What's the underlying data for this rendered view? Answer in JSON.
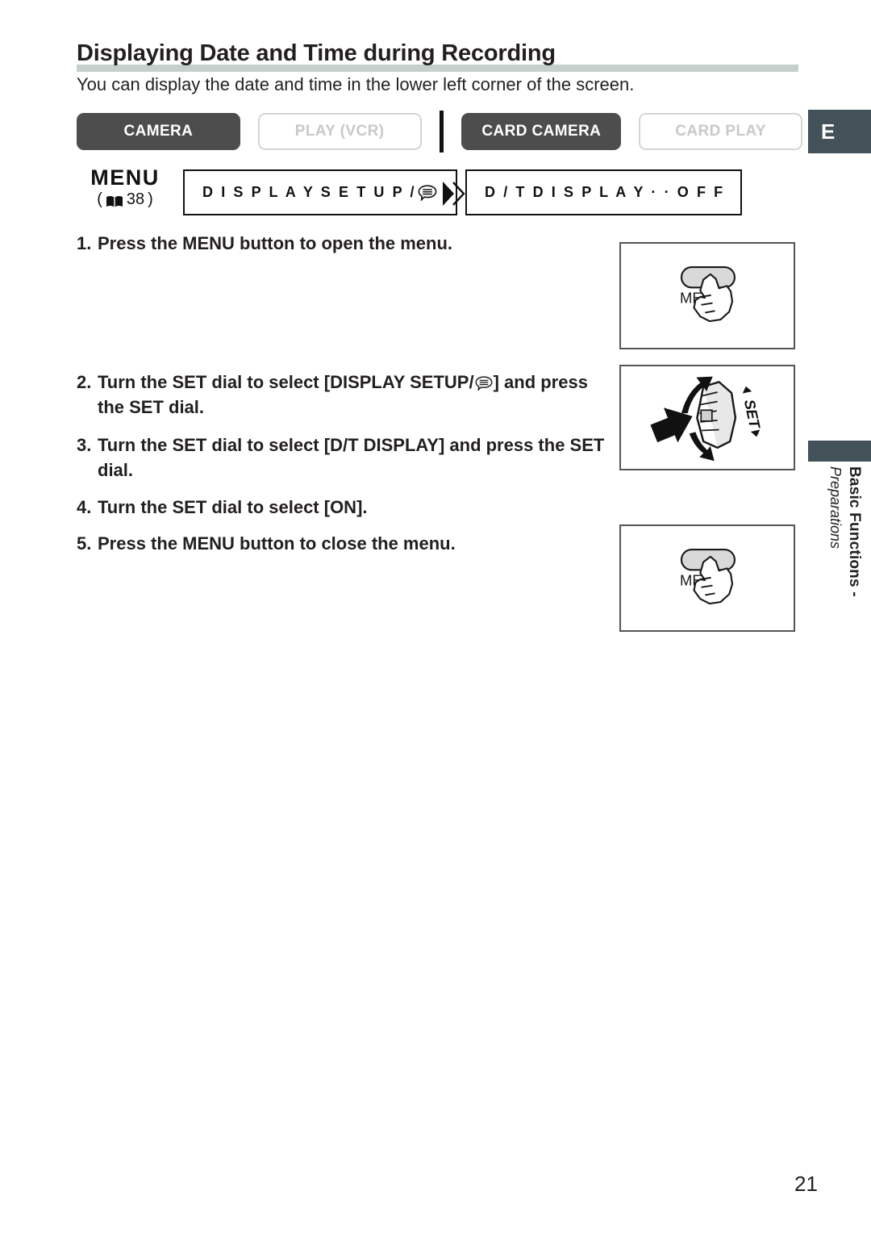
{
  "header": {
    "title": "Displaying Date and Time during Recording",
    "intro": "You can display the date and time in the lower left corner of the screen."
  },
  "modes": [
    {
      "label": "CAMERA",
      "state": "on"
    },
    {
      "label": "PLAY (VCR)",
      "state": "off"
    },
    {
      "label": "CARD CAMERA",
      "state": "on"
    },
    {
      "label": "CARD PLAY",
      "state": "off"
    }
  ],
  "language_tab": {
    "label": "E"
  },
  "menu_flow": {
    "menu_word": "MENU",
    "reference_open": "(",
    "reference_page": "38",
    "reference_close": ")",
    "book_icon": "book-icon",
    "arrow_icon": "double-chevron-right-icon",
    "box1": {
      "text": "D I S P L A Y   S E T U P /",
      "icon": "osd-bubble-icon"
    },
    "box2": {
      "text": "D / T   D I S P L A Y · · O F F"
    }
  },
  "steps": [
    {
      "num": "1.",
      "text": "Press the MENU button to open the menu.",
      "before_icon": null,
      "after_icon": null
    },
    {
      "num": "2.",
      "text_before": "Turn the SET dial to select [DISPLAY SETUP/",
      "icon": "osd-bubble-icon",
      "text_after": "] and press the SET dial."
    },
    {
      "num": "3.",
      "text": "Turn the SET dial to select [D/T DISPLAY] and press the SET dial."
    },
    {
      "num": "4.",
      "text": "Turn the SET dial to select [ON]."
    },
    {
      "num": "5.",
      "text": "Press the MENU button to close the menu."
    }
  ],
  "illustrations": [
    {
      "name": "hand-pressing-menu-button",
      "button_label": "MENU"
    },
    {
      "name": "set-dial-turn-and-press",
      "dial_label": "SET"
    },
    {
      "name": "hand-pressing-menu-button",
      "button_label": "MENU"
    }
  ],
  "side_tab": {
    "main": "Basic Functions -",
    "sub": "Preparations"
  },
  "page_number": "21",
  "colors": {
    "slate": "#435159",
    "button_on": "#4d4d4d",
    "button_off_border": "#d5d5d5",
    "button_off_text": "#c9c9c9",
    "title_rule": "#c5d0cd",
    "ink": "#231f20"
  }
}
